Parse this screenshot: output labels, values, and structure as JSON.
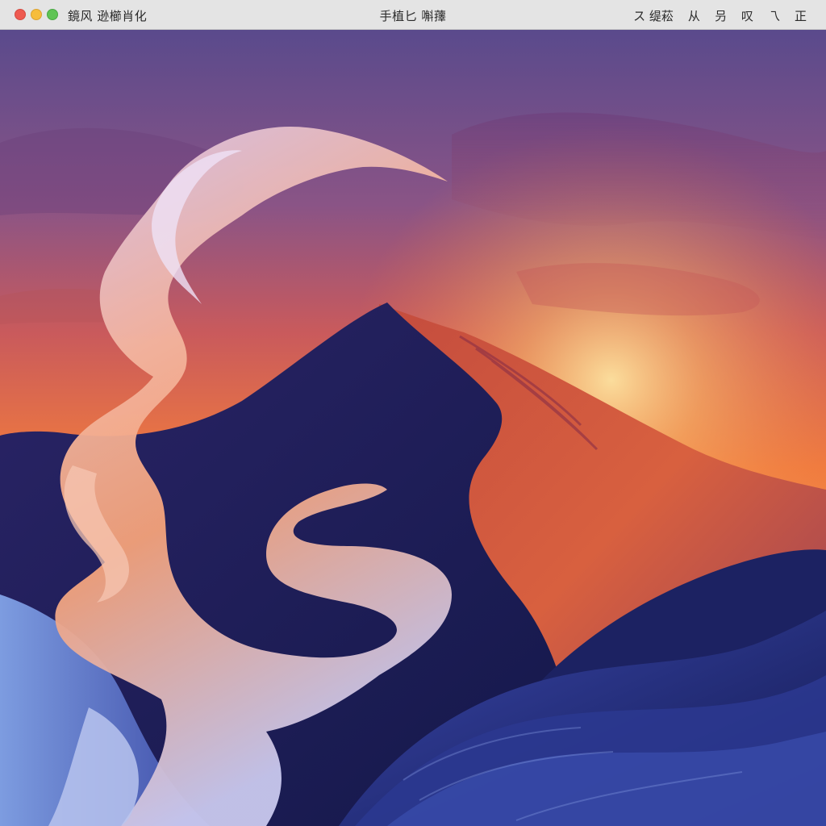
{
  "window": {
    "left_title": "鏡风 逊櫛肖化",
    "center_title": "手植匕 嘝蘀",
    "menu": [
      "ス 缇菘",
      "从",
      "叧",
      "叹",
      "乁",
      "正"
    ]
  },
  "colors": {
    "sky_top": "#5a4a8c",
    "sky_orange": "#f07a3e",
    "sun": "#fde3a0",
    "mountain_shadow": "#1c1a5a",
    "mountain_lit": "#d2583e",
    "ribbon_light": "#d9c6ee",
    "ribbon_peach": "#f4a27a",
    "waves_blue": "#2a3488"
  }
}
